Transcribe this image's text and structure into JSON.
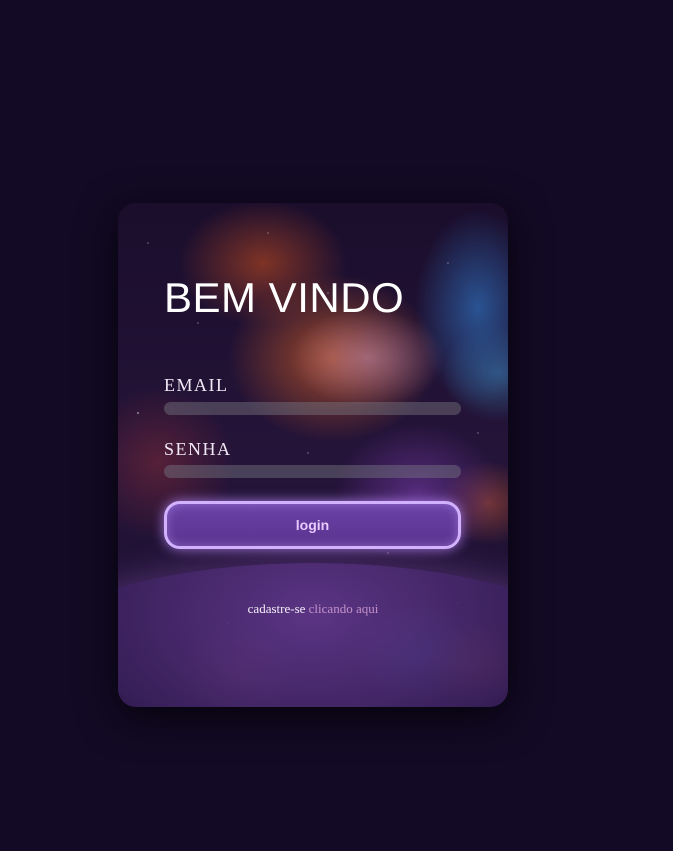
{
  "card": {
    "title": "BEM VINDO",
    "email_label": "EMAIL",
    "password_label": "SENHA",
    "email_value": "",
    "password_value": "",
    "login_label": "login",
    "signup_text": "cadastre-se",
    "signup_link": "clicando aqui"
  },
  "colors": {
    "page_background": "#130a25",
    "button_fill": "#5f3696",
    "button_border": "#d2b2ff",
    "button_text": "#e7c9ff",
    "link": "#c391c9"
  }
}
